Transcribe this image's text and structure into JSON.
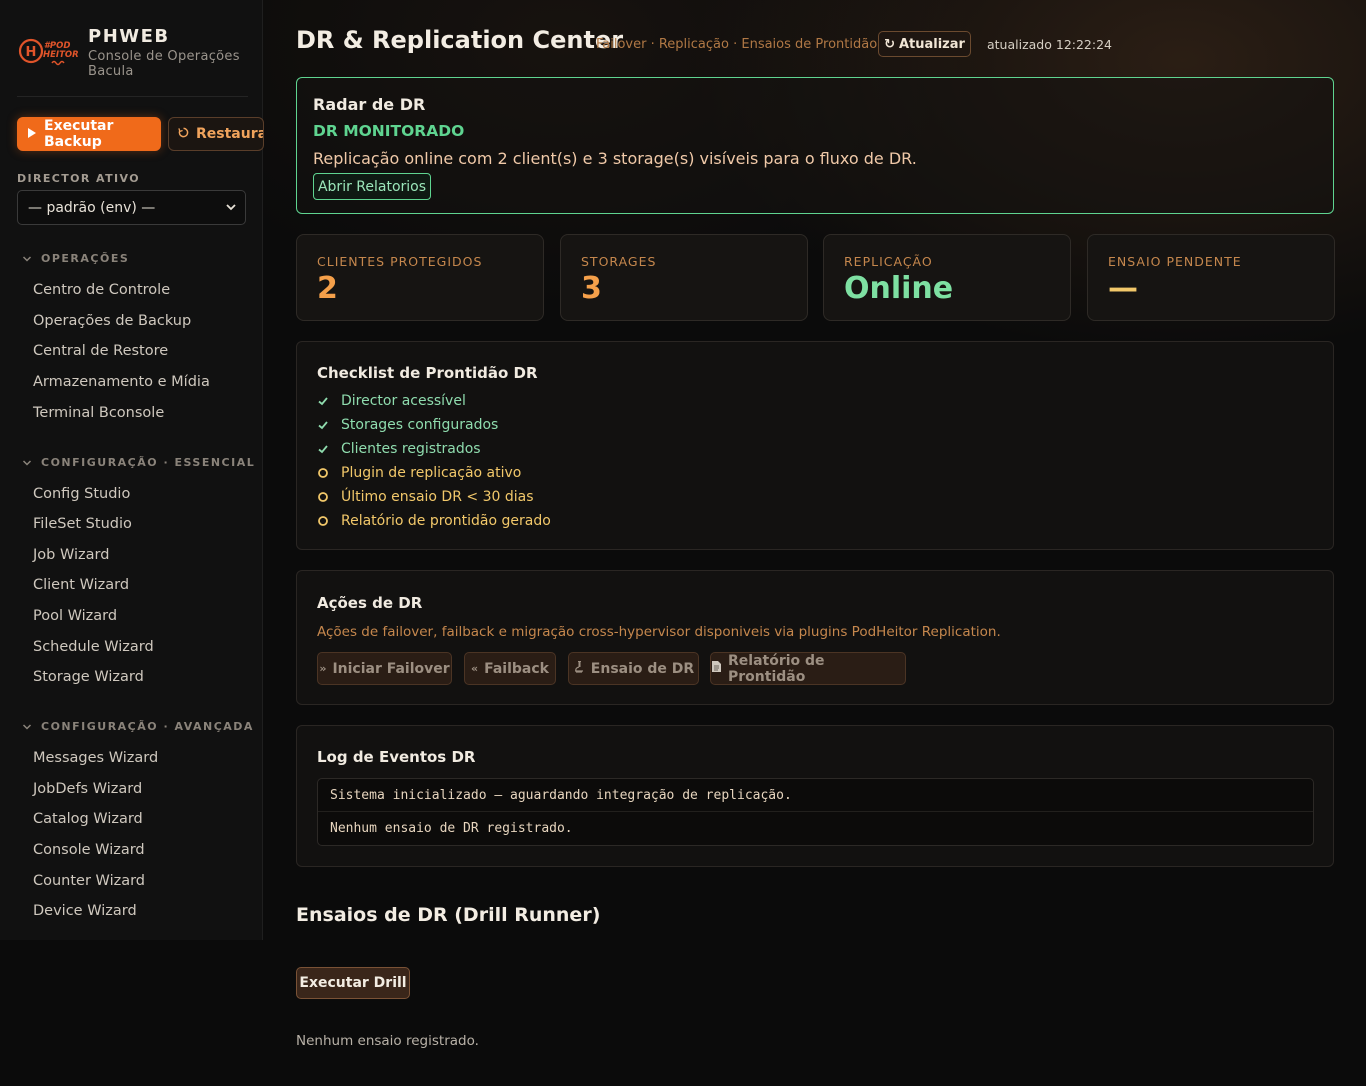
{
  "brand": {
    "name": "PHWEB",
    "subtitle": "Console de Operações Bacula",
    "logo_text": "#POD HEITOR"
  },
  "sidebar": {
    "backup_label": "Executar Backup",
    "restore_label": "Restaurar",
    "director_label": "DIRECTOR ATIVO",
    "director_value": "— padrão (env) —",
    "sections": [
      {
        "title": "OPERAÇÕES",
        "items": [
          "Centro de Controle",
          "Operações de Backup",
          "Central de Restore",
          "Armazenamento e Mídia",
          "Terminal Bconsole"
        ]
      },
      {
        "title": "CONFIGURAÇÃO · ESSENCIAL",
        "items": [
          "Config Studio",
          "FileSet Studio",
          "Job Wizard",
          "Client Wizard",
          "Pool Wizard",
          "Schedule Wizard",
          "Storage Wizard"
        ]
      },
      {
        "title": "CONFIGURAÇÃO · AVANÇADA",
        "items": [
          "Messages Wizard",
          "JobDefs Wizard",
          "Catalog Wizard",
          "Console Wizard",
          "Counter Wizard",
          "Device Wizard"
        ]
      }
    ]
  },
  "header": {
    "title": "DR & Replication Center",
    "subtitle": "Failover · Replicação · Ensaios de Prontidão",
    "refresh_label": "Atualizar",
    "updated": "atualizado 12:22:24"
  },
  "radar": {
    "title": "Radar de DR",
    "status": "DR MONITORADO",
    "description": "Replicação online com 2 client(s) e 3 storage(s) visíveis para o fluxo de DR.",
    "button": "Abrir Relatorios"
  },
  "kpis": [
    {
      "label": "CLIENTES PROTEGIDOS",
      "value": "2",
      "color": "#f5a04a"
    },
    {
      "label": "STORAGES",
      "value": "3",
      "color": "#f5a04a"
    },
    {
      "label": "REPLICAÇÃO",
      "value": "Online",
      "color": "#7ee0a2"
    },
    {
      "label": "ENSAIO PENDENTE",
      "value": "—",
      "color": "#f2c86a"
    }
  ],
  "checklist": {
    "title": "Checklist de Prontidão DR",
    "items": [
      {
        "label": "Director acessível",
        "state": "ok"
      },
      {
        "label": "Storages configurados",
        "state": "ok"
      },
      {
        "label": "Clientes registrados",
        "state": "ok"
      },
      {
        "label": "Plugin de replicação ativo",
        "state": "pending"
      },
      {
        "label": "Último ensaio DR < 30 dias",
        "state": "pending"
      },
      {
        "label": "Relatório de prontidão gerado",
        "state": "pending"
      }
    ]
  },
  "actions": {
    "title": "Ações de DR",
    "description": "Ações de failover, failback e migração cross-hypervisor disponiveis via plugins PodHeitor Replication.",
    "buttons": [
      "Iniciar Failover",
      "Failback",
      "Ensaio de DR",
      "Relatório de Prontidão"
    ]
  },
  "log": {
    "title": "Log de Eventos DR",
    "lines": [
      "Sistema inicializado — aguardando integração de replicação.",
      "Nenhum ensaio de DR registrado."
    ]
  },
  "drill": {
    "title": "Ensaios de DR (Drill Runner)",
    "button": "Executar Drill",
    "empty": "Nenhum ensaio registrado."
  }
}
